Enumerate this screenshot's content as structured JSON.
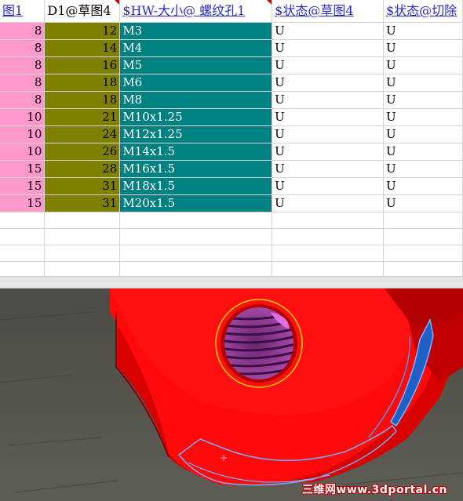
{
  "spreadsheet": {
    "headers": [
      "图1",
      "D1@草图4",
      "$HW-大小@ 螺纹孔1",
      "$状态@草图4",
      "$状态@切除"
    ],
    "rows": [
      [
        "8",
        "12",
        "M3",
        "U",
        "U"
      ],
      [
        "8",
        "14",
        "M4",
        "U",
        "U"
      ],
      [
        "8",
        "16",
        "M5",
        "U",
        "U"
      ],
      [
        "8",
        "18",
        "M6",
        "U",
        "U"
      ],
      [
        "8",
        "18",
        "M8",
        "U",
        "U"
      ],
      [
        "10",
        "21",
        "M10x1.25",
        "U",
        "U"
      ],
      [
        "10",
        "24",
        "M12x1.25",
        "U",
        "U"
      ],
      [
        "10",
        "26",
        "M14x1.5",
        "U",
        "U"
      ],
      [
        "15",
        "28",
        "M16x1.5",
        "U",
        "U"
      ],
      [
        "15",
        "31",
        "M18x1.5",
        "U",
        "U"
      ],
      [
        "15",
        "31",
        "M20x1.5",
        "U",
        "U"
      ]
    ]
  },
  "colors": {
    "col_a_fill": "#ff99cc",
    "col_b_fill": "#808000",
    "col_c_fill": "#008080",
    "model_red": "#ff0000",
    "hole_purple": "#8a2f8f",
    "selection_blue": "#1f5fc8"
  },
  "viewport": {
    "watermark": "三维网www.3dportal.cn"
  }
}
